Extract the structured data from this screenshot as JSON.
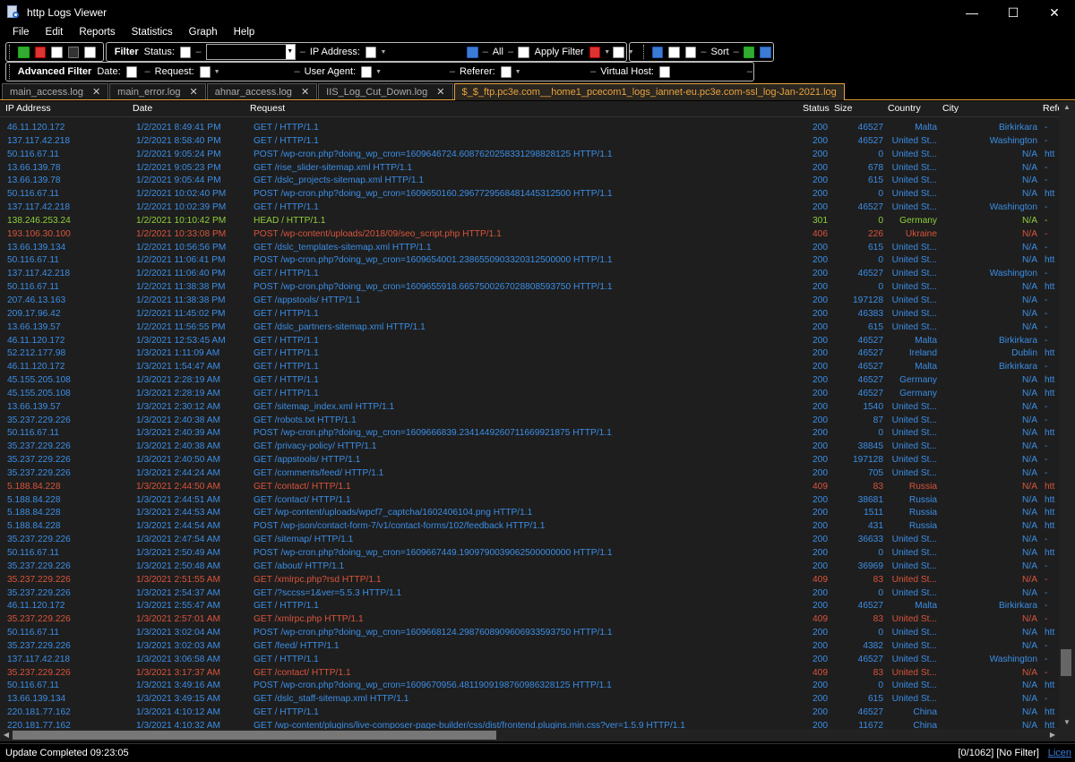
{
  "window": {
    "title": "http Logs Viewer",
    "minimize": "—",
    "maximize": "☐",
    "close": "✕"
  },
  "menu": [
    "File",
    "Edit",
    "Reports",
    "Statistics",
    "Graph",
    "Help"
  ],
  "toolbar": {
    "filter_label": "Filter",
    "status_label": "Status:",
    "ip_label": "IP Address:",
    "all_label": "All",
    "apply_filter": "Apply Filter",
    "sort_label": "Sort"
  },
  "advanced": {
    "title": "Advanced Filter",
    "date_label": "Date:",
    "request_label": "Request:",
    "useragent_label": "User Agent:",
    "referer_label": "Referer:",
    "vhost_label": "Virtual Host:"
  },
  "tabs": [
    "main_access.log",
    "main_error.log",
    "ahnar_access.log",
    "IIS_Log_Cut_Down.log",
    "$_$_ftp.pc3e.com__home1_pcecom1_logs_iannet-eu.pc3e.com-ssl_log-Jan-2021.log"
  ],
  "columns": [
    "IP Address",
    "Date",
    "Request",
    "Status",
    "Size",
    "Country",
    "City",
    "Refe"
  ],
  "rows": [
    [
      "46.11.120.172",
      "1/2/2021 8:49:41 PM",
      "GET / HTTP/1.1",
      "200",
      "46527",
      "Malta",
      "Birkirkara",
      "-"
    ],
    [
      "137.117.42.218",
      "1/2/2021 8:58:40 PM",
      "GET / HTTP/1.1",
      "200",
      "46527",
      "United St...",
      "Washington",
      "-"
    ],
    [
      "50.116.67.11",
      "1/2/2021 9:05:24 PM",
      "POST /wp-cron.php?doing_wp_cron=1609646724.6087620258331298828125 HTTP/1.1",
      "200",
      "0",
      "United St...",
      "N/A",
      "htt"
    ],
    [
      "13.66.139.78",
      "1/2/2021 9:05:23 PM",
      "GET /rise_slider-sitemap.xml HTTP/1.1",
      "200",
      "678",
      "United St...",
      "N/A",
      "-"
    ],
    [
      "13.66.139.78",
      "1/2/2021 9:05:44 PM",
      "GET /dslc_projects-sitemap.xml HTTP/1.1",
      "200",
      "615",
      "United St...",
      "N/A",
      "-"
    ],
    [
      "50.116.67.11",
      "1/2/2021 10:02:40 PM",
      "POST /wp-cron.php?doing_wp_cron=1609650160.2967729568481445312500 HTTP/1.1",
      "200",
      "0",
      "United St...",
      "N/A",
      "htt"
    ],
    [
      "137.117.42.218",
      "1/2/2021 10:02:39 PM",
      "GET / HTTP/1.1",
      "200",
      "46527",
      "United St...",
      "Washington",
      "-"
    ],
    [
      "138.246.253.24",
      "1/2/2021 10:10:42 PM",
      "HEAD / HTTP/1.1",
      "301",
      "0",
      "Germany",
      "N/A",
      "-"
    ],
    [
      "193.106.30.100",
      "1/2/2021 10:33:08 PM",
      "POST /wp-content/uploads/2018/09/seo_script.php HTTP/1.1",
      "406",
      "226",
      "Ukraine",
      "N/A",
      "-"
    ],
    [
      "13.66.139.134",
      "1/2/2021 10:56:56 PM",
      "GET /dslc_templates-sitemap.xml HTTP/1.1",
      "200",
      "615",
      "United St...",
      "N/A",
      "-"
    ],
    [
      "50.116.67.11",
      "1/2/2021 11:06:41 PM",
      "POST /wp-cron.php?doing_wp_cron=1609654001.2386550903320312500000 HTTP/1.1",
      "200",
      "0",
      "United St...",
      "N/A",
      "htt"
    ],
    [
      "137.117.42.218",
      "1/2/2021 11:06:40 PM",
      "GET / HTTP/1.1",
      "200",
      "46527",
      "United St...",
      "Washington",
      "-"
    ],
    [
      "50.116.67.11",
      "1/2/2021 11:38:38 PM",
      "POST /wp-cron.php?doing_wp_cron=1609655918.6657500267028808593750 HTTP/1.1",
      "200",
      "0",
      "United St...",
      "N/A",
      "htt"
    ],
    [
      "207.46.13.163",
      "1/2/2021 11:38:38 PM",
      "GET /appstools/ HTTP/1.1",
      "200",
      "197128",
      "United St...",
      "N/A",
      "-"
    ],
    [
      "209.17.96.42",
      "1/2/2021 11:45:02 PM",
      "GET / HTTP/1.1",
      "200",
      "46383",
      "United St...",
      "N/A",
      "-"
    ],
    [
      "13.66.139.57",
      "1/2/2021 11:56:55 PM",
      "GET /dslc_partners-sitemap.xml HTTP/1.1",
      "200",
      "615",
      "United St...",
      "N/A",
      "-"
    ],
    [
      "46.11.120.172",
      "1/3/2021 12:53:45 AM",
      "GET / HTTP/1.1",
      "200",
      "46527",
      "Malta",
      "Birkirkara",
      "-"
    ],
    [
      "52.212.177.98",
      "1/3/2021 1:11:09 AM",
      "GET / HTTP/1.1",
      "200",
      "46527",
      "Ireland",
      "Dublin",
      "htt"
    ],
    [
      "46.11.120.172",
      "1/3/2021 1:54:47 AM",
      "GET / HTTP/1.1",
      "200",
      "46527",
      "Malta",
      "Birkirkara",
      "-"
    ],
    [
      "45.155.205.108",
      "1/3/2021 2:28:19 AM",
      "GET / HTTP/1.1",
      "200",
      "46527",
      "Germany",
      "N/A",
      "htt"
    ],
    [
      "45.155.205.108",
      "1/3/2021 2:28:19 AM",
      "GET / HTTP/1.1",
      "200",
      "46527",
      "Germany",
      "N/A",
      "htt"
    ],
    [
      "13.66.139.57",
      "1/3/2021 2:30:12 AM",
      "GET /sitemap_index.xml HTTP/1.1",
      "200",
      "1540",
      "United St...",
      "N/A",
      "-"
    ],
    [
      "35.237.229.226",
      "1/3/2021 2:40:38 AM",
      "GET /robots.txt HTTP/1.1",
      "200",
      "87",
      "United St...",
      "N/A",
      "-"
    ],
    [
      "50.116.67.11",
      "1/3/2021 2:40:39 AM",
      "POST /wp-cron.php?doing_wp_cron=1609666839.2341449260711669921875 HTTP/1.1",
      "200",
      "0",
      "United St...",
      "N/A",
      "htt"
    ],
    [
      "35.237.229.226",
      "1/3/2021 2:40:38 AM",
      "GET /privacy-policy/ HTTP/1.1",
      "200",
      "38845",
      "United St...",
      "N/A",
      "-"
    ],
    [
      "35.237.229.226",
      "1/3/2021 2:40:50 AM",
      "GET /appstools/ HTTP/1.1",
      "200",
      "197128",
      "United St...",
      "N/A",
      "-"
    ],
    [
      "35.237.229.226",
      "1/3/2021 2:44:24 AM",
      "GET /comments/feed/ HTTP/1.1",
      "200",
      "705",
      "United St...",
      "N/A",
      "-"
    ],
    [
      "5.188.84.228",
      "1/3/2021 2:44:50 AM",
      "GET /contact/ HTTP/1.1",
      "409",
      "83",
      "Russia",
      "N/A",
      "htt"
    ],
    [
      "5.188.84.228",
      "1/3/2021 2:44:51 AM",
      "GET /contact/ HTTP/1.1",
      "200",
      "38681",
      "Russia",
      "N/A",
      "htt"
    ],
    [
      "5.188.84.228",
      "1/3/2021 2:44:53 AM",
      "GET /wp-content/uploads/wpcf7_captcha/1602406104.png HTTP/1.1",
      "200",
      "1511",
      "Russia",
      "N/A",
      "htt"
    ],
    [
      "5.188.84.228",
      "1/3/2021 2:44:54 AM",
      "POST /wp-json/contact-form-7/v1/contact-forms/102/feedback HTTP/1.1",
      "200",
      "431",
      "Russia",
      "N/A",
      "htt"
    ],
    [
      "35.237.229.226",
      "1/3/2021 2:47:54 AM",
      "GET /sitemap/ HTTP/1.1",
      "200",
      "36633",
      "United St...",
      "N/A",
      "-"
    ],
    [
      "50.116.67.11",
      "1/3/2021 2:50:49 AM",
      "POST /wp-cron.php?doing_wp_cron=1609667449.1909790039062500000000 HTTP/1.1",
      "200",
      "0",
      "United St...",
      "N/A",
      "htt"
    ],
    [
      "35.237.229.226",
      "1/3/2021 2:50:48 AM",
      "GET /about/ HTTP/1.1",
      "200",
      "36969",
      "United St...",
      "N/A",
      "-"
    ],
    [
      "35.237.229.226",
      "1/3/2021 2:51:55 AM",
      "GET /xmlrpc.php?rsd HTTP/1.1",
      "409",
      "83",
      "United St...",
      "N/A",
      "-"
    ],
    [
      "35.237.229.226",
      "1/3/2021 2:54:37 AM",
      "GET /?sccss=1&ver=5.5.3 HTTP/1.1",
      "200",
      "0",
      "United St...",
      "N/A",
      "-"
    ],
    [
      "46.11.120.172",
      "1/3/2021 2:55:47 AM",
      "GET / HTTP/1.1",
      "200",
      "46527",
      "Malta",
      "Birkirkara",
      "-"
    ],
    [
      "35.237.229.226",
      "1/3/2021 2:57:01 AM",
      "GET /xmlrpc.php HTTP/1.1",
      "409",
      "83",
      "United St...",
      "N/A",
      "-"
    ],
    [
      "50.116.67.11",
      "1/3/2021 3:02:04 AM",
      "POST /wp-cron.php?doing_wp_cron=1609668124.2987608909606933593750 HTTP/1.1",
      "200",
      "0",
      "United St...",
      "N/A",
      "htt"
    ],
    [
      "35.237.229.226",
      "1/3/2021 3:02:03 AM",
      "GET /feed/ HTTP/1.1",
      "200",
      "4382",
      "United St...",
      "N/A",
      "-"
    ],
    [
      "137.117.42.218",
      "1/3/2021 3:06:58 AM",
      "GET / HTTP/1.1",
      "200",
      "46527",
      "United St...",
      "Washington",
      "-"
    ],
    [
      "35.237.229.226",
      "1/3/2021 3:17:37 AM",
      "GET /contact/ HTTP/1.1",
      "409",
      "83",
      "United St...",
      "N/A",
      "-"
    ],
    [
      "50.116.67.11",
      "1/3/2021 3:49:16 AM",
      "POST /wp-cron.php?doing_wp_cron=1609670956.4811909198760986328125 HTTP/1.1",
      "200",
      "0",
      "United St...",
      "N/A",
      "htt"
    ],
    [
      "13.66.139.134",
      "1/3/2021 3:49:15 AM",
      "GET /dslc_staff-sitemap.xml HTTP/1.1",
      "200",
      "615",
      "United St...",
      "N/A",
      "-"
    ],
    [
      "220.181.77.162",
      "1/3/2021 4:10:12 AM",
      "GET / HTTP/1.1",
      "200",
      "46527",
      "China",
      "N/A",
      "htt"
    ],
    [
      "220.181.77.162",
      "1/3/2021 4:10:32 AM",
      "GET /wp-content/plugins/live-composer-page-builder/css/dist/frontend.plugins.min.css?ver=1.5.9 HTTP/1.1",
      "200",
      "11672",
      "China",
      "N/A",
      "htt"
    ]
  ],
  "status": {
    "left": "Update Completed 09:23:05",
    "right": "[0/1062]  [No Filter]",
    "link": "Licen"
  }
}
